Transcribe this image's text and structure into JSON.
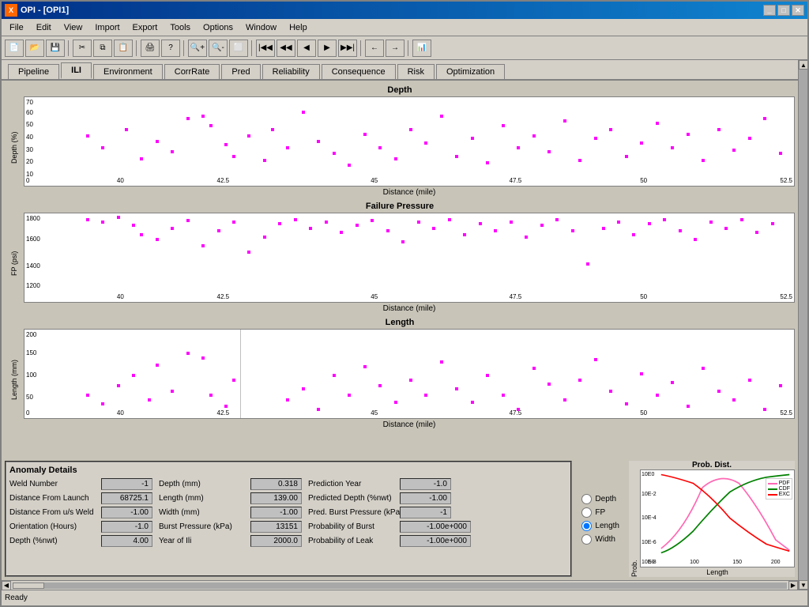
{
  "app": {
    "title": "OPI - [OPI1]",
    "icon_label": "X",
    "status": "Ready"
  },
  "menubar": {
    "items": [
      "File",
      "Edit",
      "View",
      "Import",
      "Export",
      "Tools",
      "Options",
      "Window",
      "Help"
    ]
  },
  "toolbar": {
    "buttons": [
      "new",
      "open",
      "save",
      "sep",
      "cut",
      "copy",
      "paste",
      "sep",
      "print",
      "help",
      "sep",
      "zoom-in",
      "zoom-out",
      "zoom-rect",
      "sep",
      "nav-first",
      "nav-prev-fast",
      "nav-prev",
      "nav-next",
      "nav-next-fast",
      "sep",
      "nav-back",
      "nav-forward",
      "sep",
      "chart"
    ]
  },
  "tabs": {
    "items": [
      "Pipeline",
      "ILI",
      "Environment",
      "CorrRate",
      "Pred",
      "Reliability",
      "Consequence",
      "Risk",
      "Optimization"
    ],
    "active": "ILI"
  },
  "charts": [
    {
      "title": "Depth",
      "ylabel": "Depth (%)",
      "xlabel": "Distance (mile)",
      "ymax": 70,
      "ymin": 0,
      "xmin": 38,
      "xmax": 52.5,
      "yticks": [
        "70",
        "60",
        "50",
        "40",
        "30",
        "20",
        "10",
        "0"
      ],
      "xticks": [
        "40",
        "42.5",
        "45",
        "47.5",
        "50",
        "52.5"
      ]
    },
    {
      "title": "Failure Pressure",
      "ylabel": "FP (psi)",
      "xlabel": "Distance (mile)",
      "ymax": 1800,
      "ymin": 1100,
      "xmin": 38,
      "xmax": 52.5,
      "yticks": [
        "1800",
        "1600",
        "1400",
        "1200"
      ],
      "xticks": [
        "40",
        "42.5",
        "45",
        "47.5",
        "50",
        "52.5"
      ]
    },
    {
      "title": "Length",
      "ylabel": "Length (mm)",
      "xlabel": "Distance (mile)",
      "ymax": 250,
      "ymin": 0,
      "xmin": 38,
      "xmax": 52.5,
      "yticks": [
        "200",
        "150",
        "100",
        "50",
        "0"
      ],
      "xticks": [
        "40",
        "42.5",
        "45",
        "47.5",
        "50",
        "52.5"
      ]
    }
  ],
  "anomaly_details": {
    "title": "Anomaly Details",
    "col1": [
      {
        "label": "Weld Number",
        "value": "-1"
      },
      {
        "label": "Distance From Launch",
        "value": "68725.1"
      },
      {
        "label": "Distance From u/s Weld",
        "value": "-1.00"
      },
      {
        "label": "Orientation (Hours)",
        "value": "-1.0"
      },
      {
        "label": "Depth (%nwt)",
        "value": "4.00"
      }
    ],
    "col2": [
      {
        "label": "Depth (mm)",
        "value": "0.318"
      },
      {
        "label": "Length (mm)",
        "value": "139.00"
      },
      {
        "label": "Width (mm)",
        "value": "-1.00"
      },
      {
        "label": "Burst Pressure (kPa)",
        "value": "13151"
      },
      {
        "label": "Year of Ili",
        "value": "2000.0"
      }
    ],
    "col3": [
      {
        "label": "Prediction Year",
        "value": "-1.0"
      },
      {
        "label": "Predicted Depth (%nwt)",
        "value": "-1.00"
      },
      {
        "label": "Pred. Burst Pressure (kPa)",
        "value": "-1"
      },
      {
        "label": "Probability of Burst",
        "value": "-1.00e+000"
      },
      {
        "label": "Probability of Leak",
        "value": "-1.00e+000"
      }
    ]
  },
  "radio_options": [
    {
      "label": "Depth",
      "id": "r-depth",
      "checked": false
    },
    {
      "label": "FP",
      "id": "r-fp",
      "checked": false
    },
    {
      "label": "Length",
      "id": "r-length",
      "checked": true
    },
    {
      "label": "Width",
      "id": "r-width",
      "checked": false
    }
  ],
  "prob_chart": {
    "title": "Prob. Dist.",
    "xlabel": "Length",
    "ylabel": "Prob.",
    "legend": [
      {
        "label": "PDF",
        "color": "#ff69b4"
      },
      {
        "label": "CDF",
        "color": "#008000"
      },
      {
        "label": "EXC",
        "color": "#ff0000"
      }
    ],
    "xmin": 50,
    "xmax": 230,
    "xticks": [
      "50",
      "100",
      "150",
      "200"
    ],
    "yticks": [
      "10E0",
      "10E-2",
      "10E-4",
      "10E-6",
      "10E-8"
    ]
  }
}
